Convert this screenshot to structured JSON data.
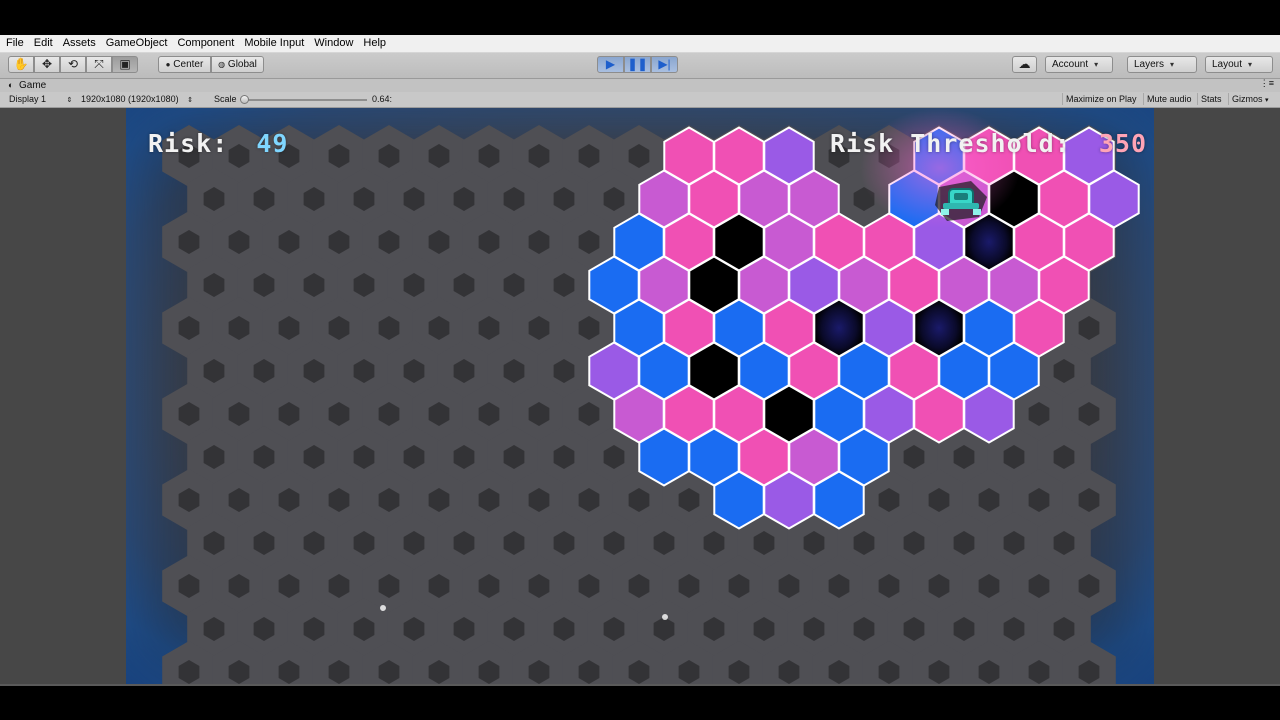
{
  "menu": [
    "File",
    "Edit",
    "Assets",
    "GameObject",
    "Component",
    "Mobile Input",
    "Window",
    "Help"
  ],
  "toolbar": {
    "tools": [
      "hand-tool",
      "move-tool",
      "rotate-tool",
      "scale-tool",
      "rect-tool"
    ],
    "pivot_label": "Center",
    "space_label": "Global",
    "account_label": "Account",
    "layers_label": "Layers",
    "layout_label": "Layout"
  },
  "game_view": {
    "tab_label": "Game",
    "display_label": "Display 1",
    "resolution_label": "1920x1080 (1920x1080)",
    "scale_label": "Scale",
    "scale_value": "0.64:",
    "scale_fraction": 0.0,
    "maximize_label": "Maximize on Play",
    "mute_label": "Mute audio",
    "stats_label": "Stats",
    "gizmos_label": "Gizmos"
  },
  "hud": {
    "risk_label": "Risk:",
    "risk_value": "49",
    "threshold_label": "Risk Threshold:",
    "threshold_value": "350"
  },
  "colors": {
    "pink": "#f050b4",
    "blue": "#1a6cf2",
    "purple": "#9a5ae6",
    "magenta": "#c85ad2",
    "black": "#000000",
    "label_white": "#f2f2f2",
    "risk_value": "#7fd6ff",
    "threshold_value": "#ffa4b6"
  }
}
